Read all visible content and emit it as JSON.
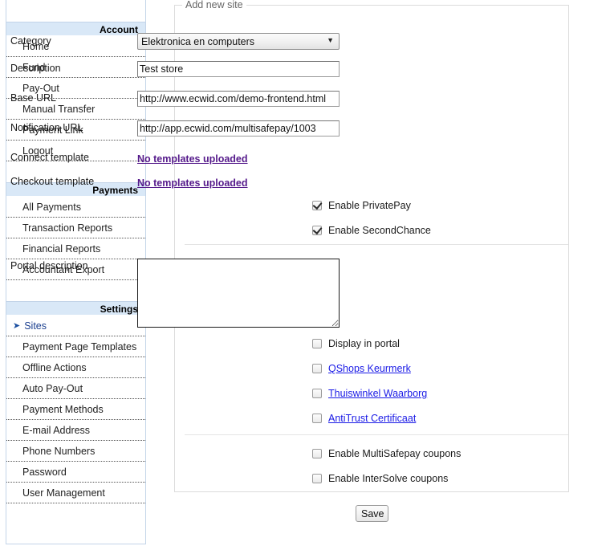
{
  "sidebar": {
    "sections": [
      {
        "header": "Account",
        "items": [
          {
            "label": "Home",
            "active": false
          },
          {
            "label": "Fund",
            "active": false
          },
          {
            "label": "Pay-Out",
            "active": false
          },
          {
            "label": "Manual Transfer",
            "active": false
          },
          {
            "label": "Payment Link",
            "active": false
          },
          {
            "label": "Logout",
            "active": false
          }
        ]
      },
      {
        "header": "Payments",
        "items": [
          {
            "label": "All Payments",
            "active": false
          },
          {
            "label": "Transaction Reports",
            "active": false
          },
          {
            "label": "Financial Reports",
            "active": false
          },
          {
            "label": "Accountant Export",
            "active": false
          }
        ]
      },
      {
        "header": "Settings",
        "items": [
          {
            "label": "Sites",
            "active": true
          },
          {
            "label": "Payment Page Templates",
            "active": false
          },
          {
            "label": "Offline Actions",
            "active": false
          },
          {
            "label": "Auto Pay-Out",
            "active": false
          },
          {
            "label": "Payment Methods",
            "active": false
          },
          {
            "label": "E-mail Address",
            "active": false
          },
          {
            "label": "Phone Numbers",
            "active": false
          },
          {
            "label": "Password",
            "active": false
          },
          {
            "label": "User Management",
            "active": false
          }
        ]
      }
    ],
    "active_marker": "➤"
  },
  "form": {
    "legend": "Add new site",
    "category": {
      "label": "Category",
      "selected": "Elektronica en computers",
      "options": [
        "Elektronica en computers"
      ],
      "arrow_icon": "▼"
    },
    "description": {
      "label": "Description",
      "value": "Test store",
      "placeholder": ""
    },
    "base_url": {
      "label": "Base URL",
      "value": "http://www.ecwid.com/demo-frontend.html",
      "placeholder": ""
    },
    "notification_url": {
      "label": "Notification URL",
      "value": "http://app.ecwid.com/multisafepay/1003",
      "placeholder": ""
    },
    "connect_template": {
      "label": "Connect template",
      "link_text": "No templates uploaded"
    },
    "checkout_template": {
      "label": "Checkout template",
      "link_text": "No templates uploaded"
    },
    "enable_privatepay": {
      "label": "Enable PrivatePay",
      "checked": true
    },
    "enable_secondchance": {
      "label": "Enable SecondChance",
      "checked": true
    },
    "portal_description": {
      "label": "Portal description",
      "value": "",
      "placeholder": ""
    },
    "display_in_portal": {
      "label": "Display in portal",
      "checked": false
    },
    "qshops": {
      "label": "QShops Keurmerk",
      "checked": false
    },
    "thuiswinkel": {
      "label": "Thuiswinkel Waarborg",
      "checked": false
    },
    "antitrust": {
      "label": "AntiTrust Certificaat",
      "checked": false
    },
    "multisafepay_coupons": {
      "label": "Enable MultiSafepay coupons",
      "checked": false
    },
    "intersolve_coupons": {
      "label": "Enable InterSolve coupons",
      "checked": false
    },
    "save_label": "Save"
  },
  "colors": {
    "sidebar_header_bg": "#d9e8f7",
    "sidebar_border": "#c3d4e8",
    "active_item": "#1b3f8f",
    "visited_link": "#551a8b",
    "link": "#1a1ae6",
    "legend_text": "#666666"
  }
}
